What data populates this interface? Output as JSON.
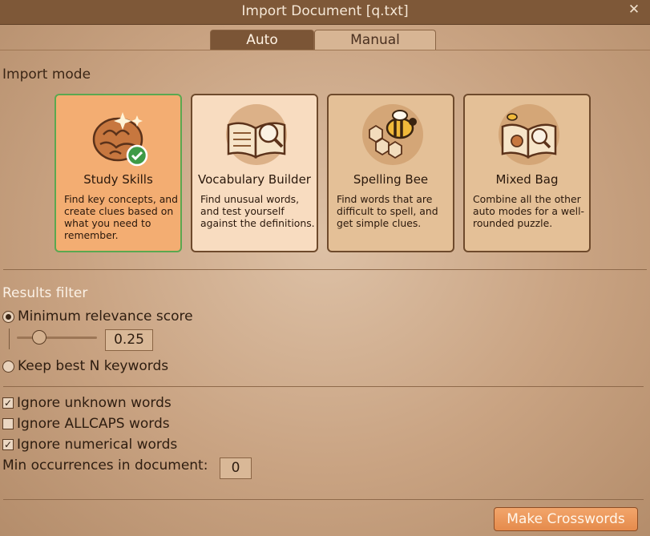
{
  "window": {
    "title": "Import Document [q.txt]",
    "close_glyph": "✕"
  },
  "tabs": [
    {
      "label": "Auto"
    },
    {
      "label": "Manual"
    }
  ],
  "import_mode": {
    "label": "Import mode",
    "cards": [
      {
        "title": "Study Skills",
        "description": "Find key concepts, and create clues based on what you need to remember.",
        "icon": "brain-icon"
      },
      {
        "title": "Vocabulary Builder",
        "description": "Find unusual words, and test yourself against the definitions.",
        "icon": "book-magnifier-icon"
      },
      {
        "title": "Spelling Bee",
        "description": "Find words that are difficult to spell, and get simple clues.",
        "icon": "bee-icon"
      },
      {
        "title": "Mixed Bag",
        "description": "Combine all the other auto modes for a well-rounded puzzle.",
        "icon": "mixed-book-icon"
      }
    ],
    "selected_index": 0
  },
  "results_filter": {
    "label": "Results filter",
    "min_relevance": {
      "label": "Minimum relevance score",
      "value": "0.25"
    },
    "keep_best": {
      "label": "Keep best N keywords"
    }
  },
  "options": {
    "ignore_unknown": {
      "label": "Ignore unknown words",
      "checked": true
    },
    "ignore_allcaps": {
      "label": "Ignore ALLCAPS words",
      "checked": false
    },
    "ignore_numerical": {
      "label": "Ignore numerical words",
      "checked": true
    },
    "min_occurrences": {
      "label": "Min occurrences in document:",
      "value": "0"
    },
    "check_glyph": "✓"
  },
  "actions": {
    "make_label": "Make Crosswords"
  },
  "colors": {
    "selected_border": "#5aa850",
    "button": "#e58b4c",
    "titlebar": "#7e5838"
  }
}
